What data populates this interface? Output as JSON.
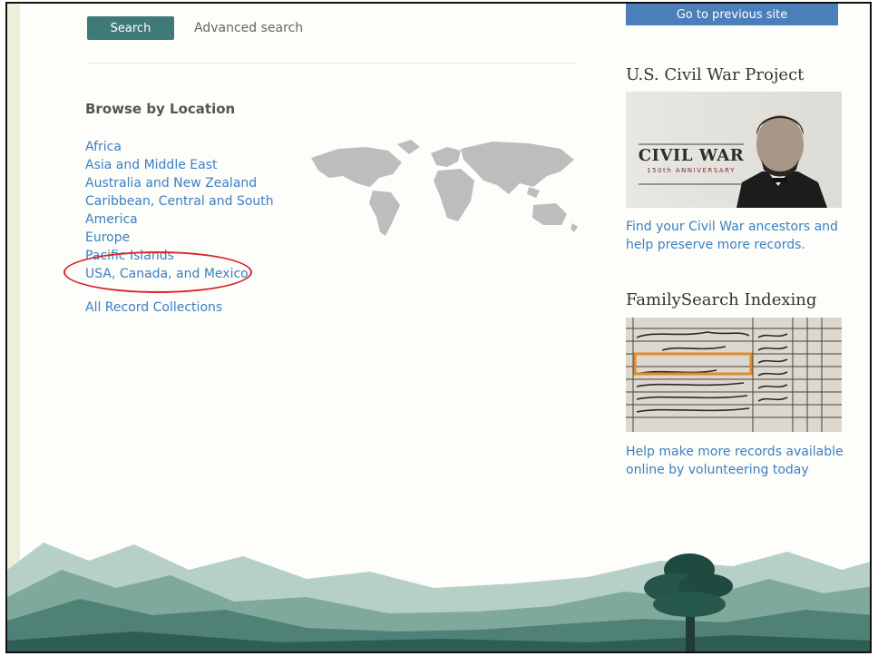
{
  "search": {
    "button_label": "Search",
    "advanced_label": "Advanced search"
  },
  "browse": {
    "title": "Browse by Location",
    "locations": [
      "Africa",
      "Asia and Middle East",
      "Australia and New Zealand",
      "Caribbean, Central and South",
      "America",
      "Europe",
      "Pacific Islands",
      "USA, Canada, and Mexico"
    ],
    "all_collections": "All Record Collections"
  },
  "sidebar": {
    "prev_site": "Go to previous site",
    "civil_war": {
      "title": "U.S. Civil War Project",
      "banner_main": "CIVIL WAR",
      "banner_sub": "150th ANNIVERSARY",
      "text": "Find your Civil War ancestors and help preserve more records."
    },
    "indexing": {
      "title": "FamilySearch Indexing",
      "text": "Help make more records available online by volunteering today"
    }
  },
  "colors": {
    "accent": "#3f7a79",
    "link": "#3b80c2",
    "highlight": "#d7262a"
  }
}
